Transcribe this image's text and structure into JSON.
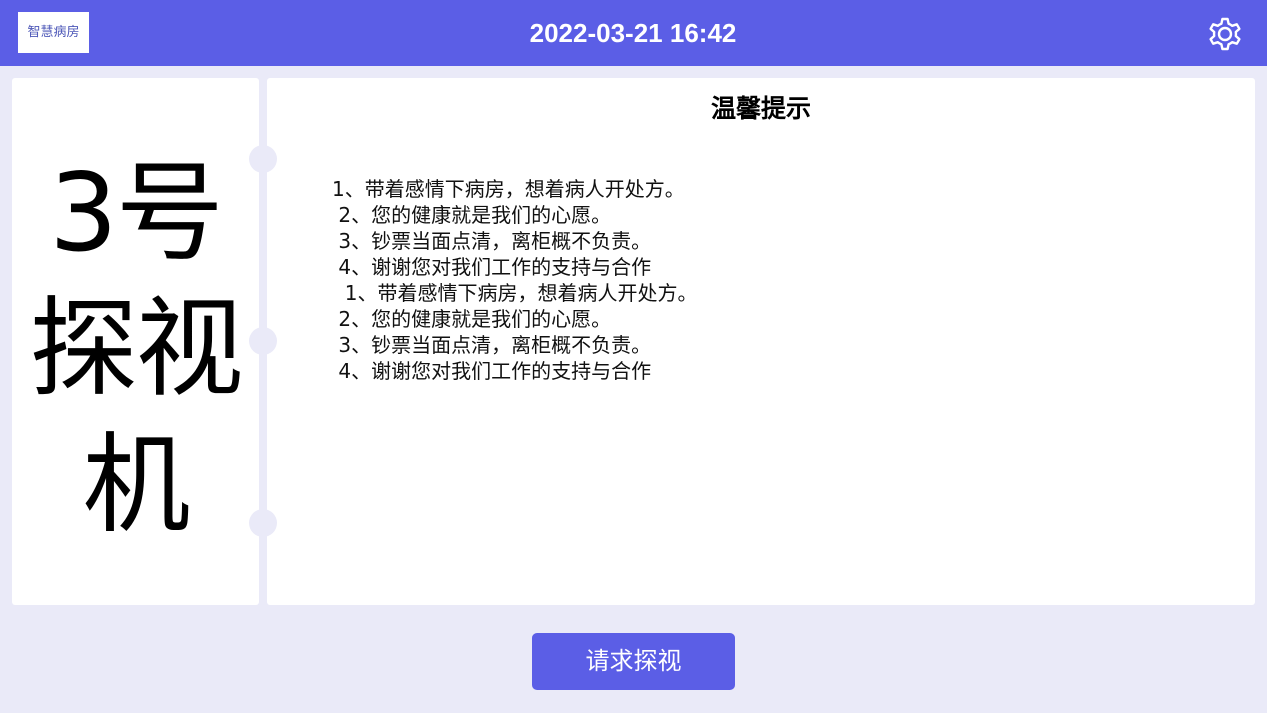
{
  "header": {
    "logo_text": "智慧病房",
    "datetime": "2022-03-21 16:42",
    "settings_icon": "gear-icon"
  },
  "left_panel": {
    "title_lines": [
      "3号",
      "探视",
      "机"
    ]
  },
  "tips": {
    "title": "温馨提示",
    "items": [
      "1、带着感情下病房，想着病人开处方。",
      " 2、您的健康就是我们的心愿。",
      " 3、钞票当面点清，离柜概不负责。",
      " 4、谢谢您对我们工作的支持与合作",
      "  1、带着感情下病房，想着病人开处方。",
      " 2、您的健康就是我们的心愿。",
      " 3、钞票当面点清，离柜概不负责。",
      " 4、谢谢您对我们工作的支持与合作"
    ]
  },
  "actions": {
    "request_label": "请求探视"
  },
  "colors": {
    "primary": "#5B5EE6",
    "background": "#EAEAF8",
    "panel": "#FFFFFF"
  }
}
